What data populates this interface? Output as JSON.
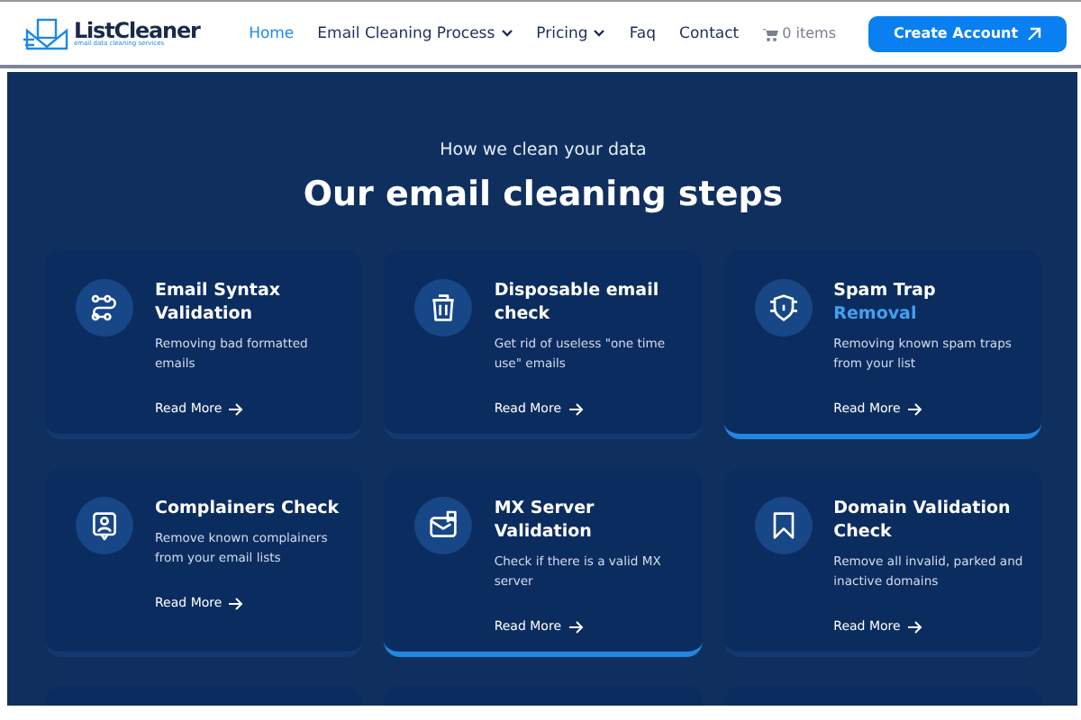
{
  "logo": {
    "name": "ListCleaner",
    "tagline": "email data cleaning services"
  },
  "nav": [
    {
      "label": "Home",
      "selected": true,
      "dropdown": false
    },
    {
      "label": "Email Cleaning Process",
      "selected": false,
      "dropdown": true
    },
    {
      "label": "Pricing",
      "selected": false,
      "dropdown": true
    },
    {
      "label": "Faq",
      "selected": false,
      "dropdown": false
    },
    {
      "label": "Contact",
      "selected": false,
      "dropdown": false
    }
  ],
  "cart": "0 items",
  "cta": "Create Account",
  "section": {
    "eyebrow": "How we clean your data",
    "heading": "Our email cleaning steps"
  },
  "cards": [
    {
      "title": "Email Syntax Validation",
      "text": "Removing bad formatted emails",
      "link": "Read More",
      "highlighted": false
    },
    {
      "title": "Disposable email check",
      "text": "Get rid of useless \"one time use\" emails",
      "link": "Read More",
      "highlighted": false
    },
    {
      "title": "Spam Trap",
      "title_accent": "Removal",
      "text": "Removing known spam traps from your list",
      "link": "Read More",
      "highlighted": true
    },
    {
      "title": "Complainers Check",
      "text": "Remove known complainers from your email lists",
      "link": "Read More",
      "highlighted": false
    },
    {
      "title": "MX Server Validation",
      "text": "Check if there is a valid MX server",
      "link": "Read More",
      "highlighted": true
    },
    {
      "title": "Domain Validation Check",
      "text": "Remove all invalid, parked and inactive domains",
      "link": "Read More",
      "highlighted": false
    }
  ]
}
